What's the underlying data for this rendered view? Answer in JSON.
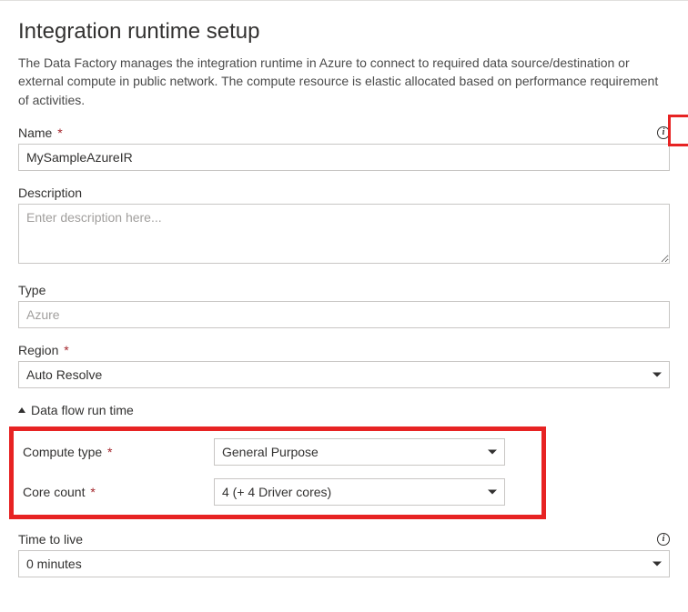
{
  "header": {
    "title": "Integration runtime setup",
    "intro": "The Data Factory manages the integration runtime in Azure to connect to required data source/destination or external compute in public network. The compute resource is elastic allocated based on performance requirement of activities."
  },
  "fields": {
    "name": {
      "label": "Name",
      "required": true,
      "value": "MySampleAzureIR",
      "has_info": true
    },
    "description": {
      "label": "Description",
      "placeholder": "Enter description here...",
      "value": ""
    },
    "type": {
      "label": "Type",
      "value": "Azure",
      "readonly": true
    },
    "region": {
      "label": "Region",
      "required": true,
      "value": "Auto Resolve"
    }
  },
  "dataflow": {
    "section_label": "Data flow run time",
    "compute_type": {
      "label": "Compute type",
      "required": true,
      "value": "General Purpose"
    },
    "core_count": {
      "label": "Core count",
      "required": true,
      "value": "4 (+ 4 Driver cores)"
    }
  },
  "ttl": {
    "label": "Time to live",
    "has_info": true,
    "value": "0 minutes"
  }
}
